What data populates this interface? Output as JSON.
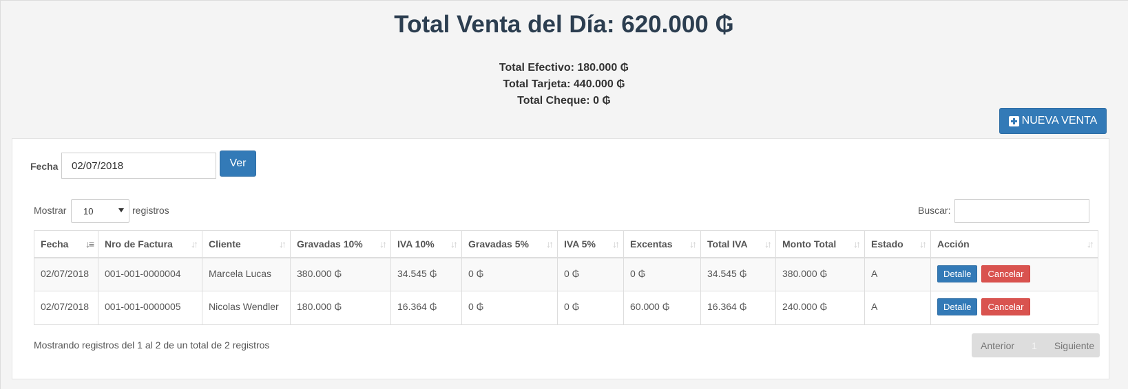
{
  "header": {
    "title": "Total Venta del Día: 620.000 ₲",
    "total_efectivo": "Total Efectivo: 180.000 ₲",
    "total_tarjeta": "Total Tarjeta: 440.000 ₲",
    "total_cheque": "Total Cheque: 0 ₲"
  },
  "toolbar": {
    "nueva_venta_label": "NUEVA VENTA"
  },
  "filter": {
    "fecha_label": "Fecha",
    "fecha_value": "02/07/2018",
    "ver_label": "Ver"
  },
  "table_controls": {
    "mostrar_label": "Mostrar",
    "page_size_value": "10",
    "registros_label": "registros",
    "buscar_label": "Buscar:",
    "buscar_value": ""
  },
  "table": {
    "columns": [
      "Fecha",
      "Nro de Factura",
      "Cliente",
      "Gravadas 10%",
      "IVA 10%",
      "Gravadas 5%",
      "IVA 5%",
      "Excentas",
      "Total IVA",
      "Monto Total",
      "Estado",
      "Acción"
    ],
    "rows": [
      {
        "fecha": "02/07/2018",
        "factura": "001-001-0000004",
        "cliente": "Marcela Lucas",
        "grav10": "380.000 ₲",
        "iva10": "34.545 ₲",
        "grav5": "0 ₲",
        "iva5": "0 ₲",
        "excentas": "0 ₲",
        "total_iva": "34.545 ₲",
        "monto_total": "380.000 ₲",
        "estado": "A",
        "detalle": "Detalle",
        "cancelar": "Cancelar"
      },
      {
        "fecha": "02/07/2018",
        "factura": "001-001-0000005",
        "cliente": "Nicolas Wendler",
        "grav10": "180.000 ₲",
        "iva10": "16.364 ₲",
        "grav5": "0 ₲",
        "iva5": "0 ₲",
        "excentas": "60.000 ₲",
        "total_iva": "16.364 ₲",
        "monto_total": "240.000 ₲",
        "estado": "A",
        "detalle": "Detalle",
        "cancelar": "Cancelar"
      }
    ]
  },
  "footer": {
    "info": "Mostrando registros del 1 al 2 de un total de 2 registros",
    "anterior": "Anterior",
    "page": "1",
    "siguiente": "Siguiente"
  }
}
